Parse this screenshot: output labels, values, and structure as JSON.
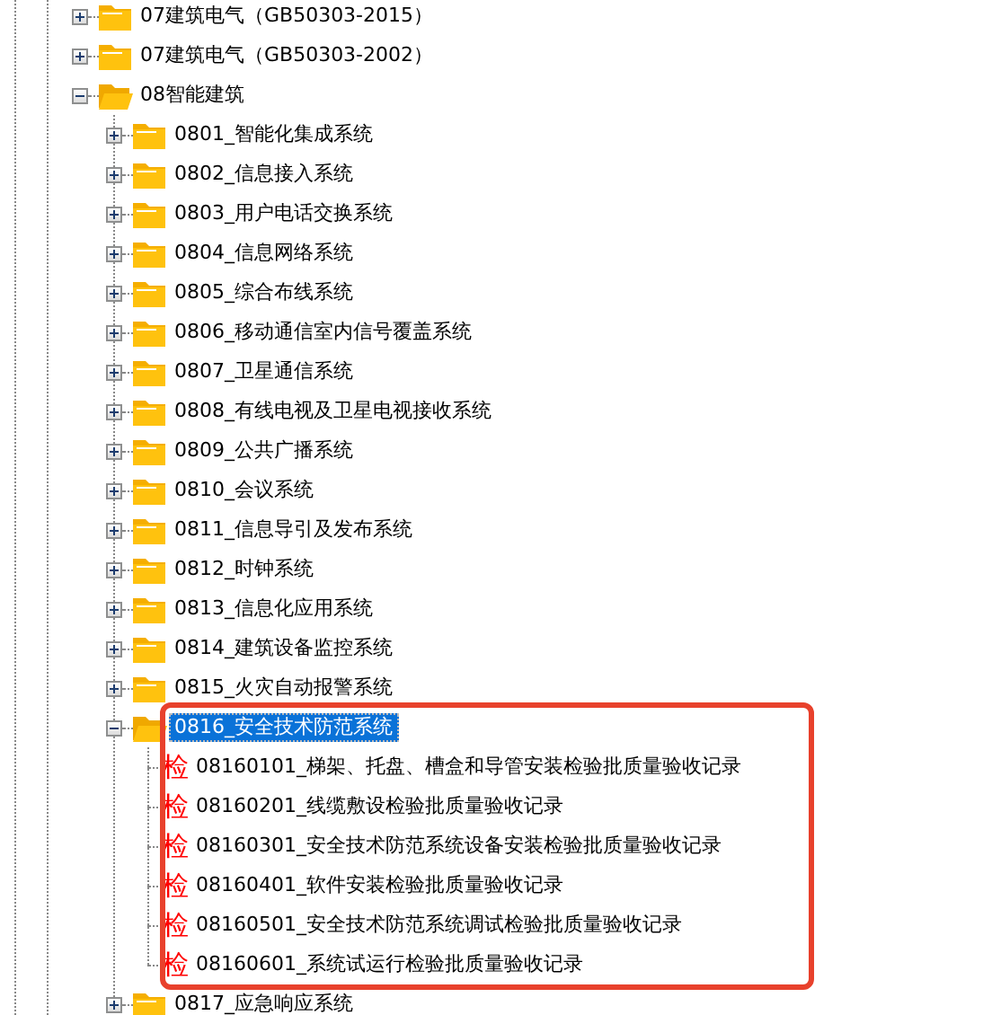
{
  "tree": [
    {
      "kind": "folder",
      "label": "07建筑电气（GB50303-2015）",
      "expanded": false,
      "selected": false
    },
    {
      "kind": "folder",
      "label": "07建筑电气（GB50303-2002）",
      "expanded": false,
      "selected": false
    },
    {
      "kind": "folder",
      "label": "08智能建筑",
      "expanded": true,
      "selected": false,
      "children": [
        {
          "kind": "folder",
          "label": "0801_智能化集成系统",
          "expanded": false,
          "selected": false
        },
        {
          "kind": "folder",
          "label": "0802_信息接入系统",
          "expanded": false,
          "selected": false
        },
        {
          "kind": "folder",
          "label": "0803_用户电话交换系统",
          "expanded": false,
          "selected": false
        },
        {
          "kind": "folder",
          "label": "0804_信息网络系统",
          "expanded": false,
          "selected": false
        },
        {
          "kind": "folder",
          "label": "0805_综合布线系统",
          "expanded": false,
          "selected": false
        },
        {
          "kind": "folder",
          "label": "0806_移动通信室内信号覆盖系统",
          "expanded": false,
          "selected": false
        },
        {
          "kind": "folder",
          "label": "0807_卫星通信系统",
          "expanded": false,
          "selected": false
        },
        {
          "kind": "folder",
          "label": "0808_有线电视及卫星电视接收系统",
          "expanded": false,
          "selected": false
        },
        {
          "kind": "folder",
          "label": "0809_公共广播系统",
          "expanded": false,
          "selected": false
        },
        {
          "kind": "folder",
          "label": "0810_会议系统",
          "expanded": false,
          "selected": false
        },
        {
          "kind": "folder",
          "label": "0811_信息导引及发布系统",
          "expanded": false,
          "selected": false
        },
        {
          "kind": "folder",
          "label": "0812_时钟系统",
          "expanded": false,
          "selected": false
        },
        {
          "kind": "folder",
          "label": "0813_信息化应用系统",
          "expanded": false,
          "selected": false
        },
        {
          "kind": "folder",
          "label": "0814_建筑设备监控系统",
          "expanded": false,
          "selected": false
        },
        {
          "kind": "folder",
          "label": "0815_火灾自动报警系统",
          "expanded": false,
          "selected": false
        },
        {
          "kind": "folder",
          "label": "0816_安全技术防范系统",
          "expanded": true,
          "selected": true,
          "highlighted": true,
          "children": [
            {
              "kind": "form",
              "icon_text": "检",
              "label": "08160101_梯架、托盘、槽盒和导管安装检验批质量验收记录",
              "selected": false
            },
            {
              "kind": "form",
              "icon_text": "检",
              "label": "08160201_线缆敷设检验批质量验收记录",
              "selected": false
            },
            {
              "kind": "form",
              "icon_text": "检",
              "label": "08160301_安全技术防范系统设备安装检验批质量验收记录",
              "selected": false
            },
            {
              "kind": "form",
              "icon_text": "检",
              "label": "08160401_软件安装检验批质量验收记录",
              "selected": false
            },
            {
              "kind": "form",
              "icon_text": "检",
              "label": "08160501_安全技术防范系统调试检验批质量验收记录",
              "selected": false
            },
            {
              "kind": "form",
              "icon_text": "检",
              "label": "08160601_系统试运行检验批质量验收记录",
              "selected": false
            }
          ]
        },
        {
          "kind": "folder",
          "label": "0817_应急响应系统",
          "expanded": false,
          "selected": false
        }
      ]
    }
  ]
}
